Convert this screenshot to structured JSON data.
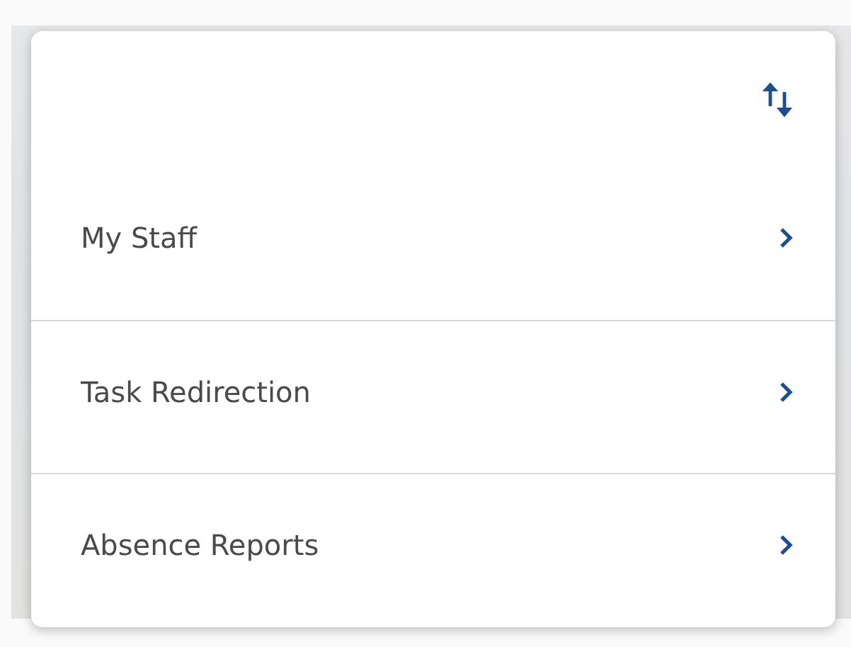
{
  "menu": {
    "items": [
      {
        "label": "My Staff"
      },
      {
        "label": "Task Redirection"
      },
      {
        "label": "Absence Reports"
      }
    ]
  }
}
